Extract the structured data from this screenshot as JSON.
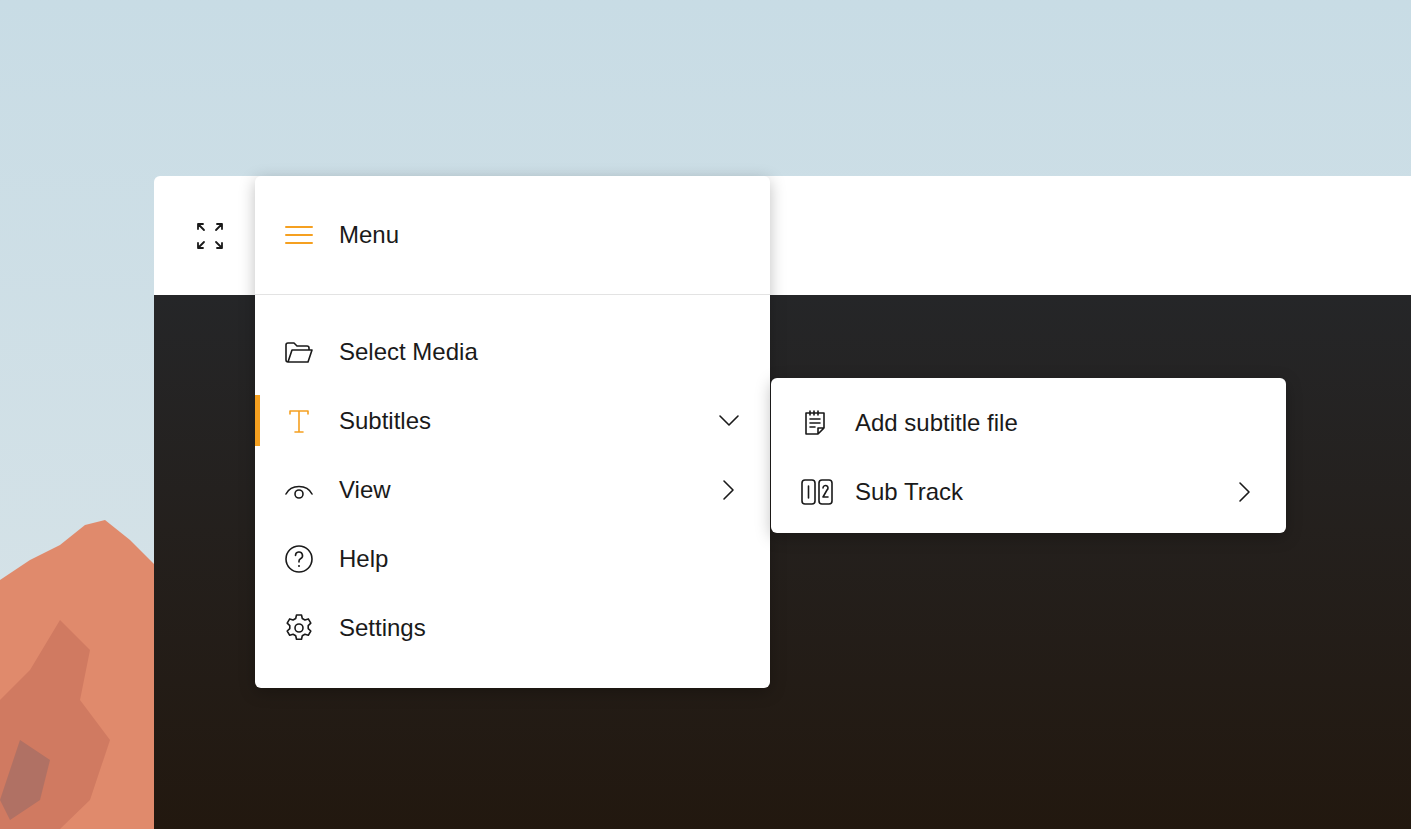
{
  "menu": {
    "title": "Menu",
    "items": [
      {
        "label": "Select Media",
        "selected": false,
        "kind": "leaf"
      },
      {
        "label": "Subtitles",
        "selected": true,
        "kind": "submenu",
        "expanded": true
      },
      {
        "label": "View",
        "selected": false,
        "kind": "submenu",
        "expanded": false
      },
      {
        "label": "Help",
        "selected": false,
        "kind": "leaf"
      },
      {
        "label": "Settings",
        "selected": false,
        "kind": "leaf"
      }
    ]
  },
  "submenu": {
    "items": [
      {
        "label": "Add subtitle file",
        "kind": "leaf"
      },
      {
        "label": "Sub Track",
        "kind": "submenu",
        "expanded": false
      }
    ]
  }
}
